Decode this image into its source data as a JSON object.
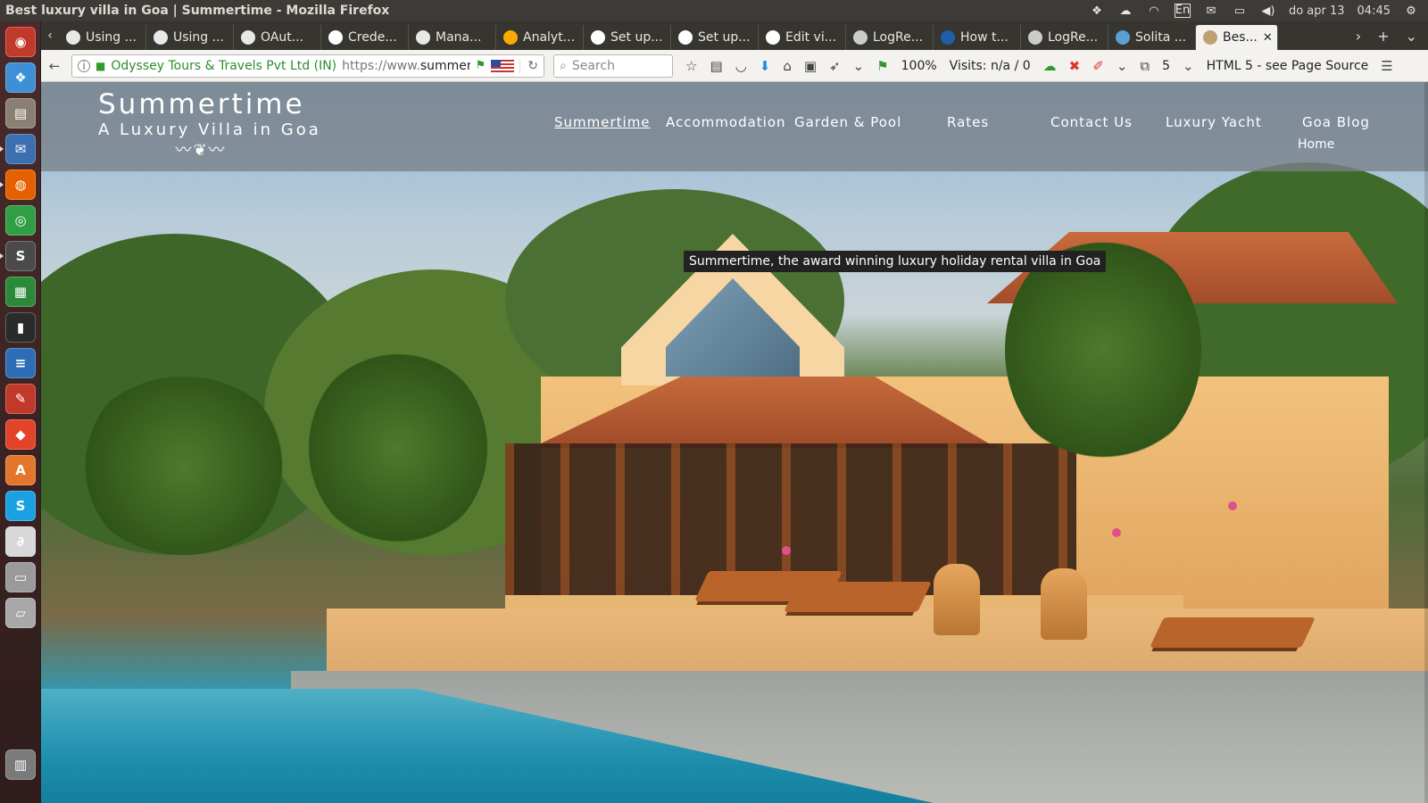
{
  "window_title": "Best luxury villa in Goa | Summertime - Mozilla Firefox",
  "system_tray": {
    "keyboard": "En",
    "date": "do apr 13",
    "time": "04:45"
  },
  "tabs": [
    {
      "label": "Using ...",
      "favicon": "circle-icon",
      "color": "#e8e8e8"
    },
    {
      "label": "Using ...",
      "favicon": "circle-icon",
      "color": "#e8e8e8"
    },
    {
      "label": "OAut...",
      "favicon": "github-icon",
      "color": "#e8e8e8"
    },
    {
      "label": "Crede...",
      "favicon": "google-icon",
      "color": "#ffffff"
    },
    {
      "label": "Mana...",
      "favicon": "circle-icon",
      "color": "#e8e8e8"
    },
    {
      "label": "Analyt...",
      "favicon": "analytics-icon",
      "color": "#f9ab00"
    },
    {
      "label": "Set up...",
      "favicon": "google-icon",
      "color": "#ffffff"
    },
    {
      "label": "Set up...",
      "favicon": "google-icon",
      "color": "#ffffff"
    },
    {
      "label": "Edit vi...",
      "favicon": "google-icon",
      "color": "#ffffff"
    },
    {
      "label": "LogRe...",
      "favicon": "logre-icon",
      "color": "#cccccc"
    },
    {
      "label": "How t...",
      "favicon": "perl-icon",
      "color": "#1f5fa8"
    },
    {
      "label": "LogRe...",
      "favicon": "logre-icon",
      "color": "#cccccc"
    },
    {
      "label": "Solita ...",
      "favicon": "solita-icon",
      "color": "#5aa0d0"
    },
    {
      "label": "Bes...",
      "favicon": "summertime-icon",
      "color": "#c0a070"
    }
  ],
  "navbar": {
    "identity": "Odyssey Tours & Travels Pvt Ltd (IN)",
    "url_prefix": "https://www.",
    "url_domain": "summertin",
    "search_placeholder": "Search",
    "zoom": "100%",
    "visits": "Visits: n/a / 0",
    "badge": "5",
    "html_info": "HTML 5 - see Page Source"
  },
  "site": {
    "logo_title": "Summertime",
    "logo_subtitle": "A Luxury Villa in Goa",
    "logo_ornament": "〰❦〰",
    "nav": [
      {
        "label": "Summertime",
        "current": true
      },
      {
        "label": "Accommodation",
        "current": false
      },
      {
        "label": "Garden & Pool",
        "current": false
      },
      {
        "label": "Rates",
        "current": false
      },
      {
        "label": "Contact Us",
        "current": false
      },
      {
        "label": "Luxury Yacht",
        "current": false
      },
      {
        "label": "Goa Blog",
        "current": false
      }
    ],
    "sub_link": "Home",
    "hero_tooltip": "Summertime, the award winning luxury holiday rental villa in Goa"
  },
  "launcher": [
    {
      "name": "ubuntu-dash-icon",
      "color": "#c0392b",
      "glyph": "◉"
    },
    {
      "name": "dropbox-icon",
      "color": "#3d8fd6",
      "glyph": "❖"
    },
    {
      "name": "file-manager-icon",
      "color": "#8a7f73",
      "glyph": "▤"
    },
    {
      "name": "thunderbird-icon",
      "color": "#3b6fb0",
      "glyph": "✉"
    },
    {
      "name": "firefox-icon",
      "color": "#e66000",
      "glyph": "◍"
    },
    {
      "name": "chrome-icon",
      "color": "#2f9e44",
      "glyph": "◎"
    },
    {
      "name": "sublime-icon",
      "color": "#4a4a4a",
      "glyph": "S"
    },
    {
      "name": "calc-icon",
      "color": "#2a8a3a",
      "glyph": "▦"
    },
    {
      "name": "terminal-icon",
      "color": "#2b2b2b",
      "glyph": "▮"
    },
    {
      "name": "writer-icon",
      "color": "#2d6db5",
      "glyph": "≡"
    },
    {
      "name": "settings-icon",
      "color": "#c0392b",
      "glyph": "✎"
    },
    {
      "name": "git-icon",
      "color": "#e24329",
      "glyph": "◆"
    },
    {
      "name": "software-center-icon",
      "color": "#e2762b",
      "glyph": "A"
    },
    {
      "name": "skype-icon",
      "color": "#1ba1e2",
      "glyph": "S"
    },
    {
      "name": "pdf-icon",
      "color": "#d8d8d8",
      "glyph": "∂"
    },
    {
      "name": "scanner-icon",
      "color": "#9a9a9a",
      "glyph": "▭"
    },
    {
      "name": "drive-icon",
      "color": "#a8a8a8",
      "glyph": "▱"
    },
    {
      "name": "trash-icon",
      "color": "#7a7a7a",
      "glyph": "▥"
    }
  ]
}
